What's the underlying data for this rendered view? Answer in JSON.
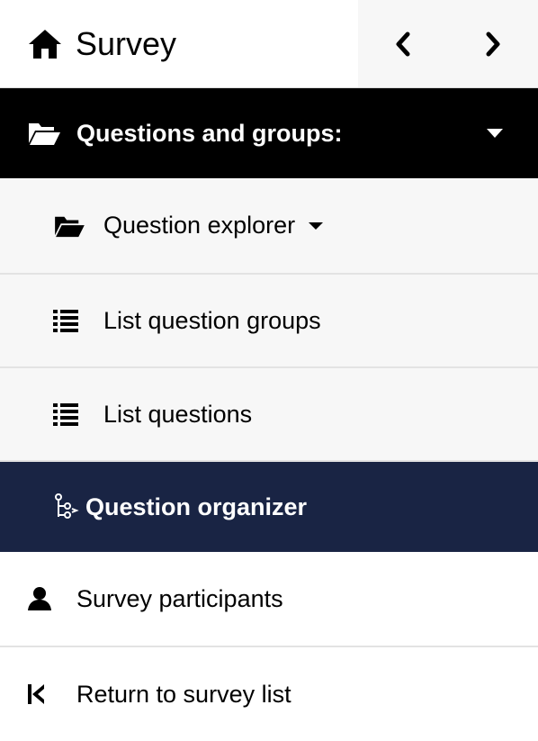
{
  "header": {
    "home_label": "Survey",
    "home_icon": "home-icon",
    "prev_icon": "chevron-left-icon",
    "next_icon": "chevron-right-icon"
  },
  "section": {
    "label": "Questions and groups:",
    "icon": "folder-open-icon",
    "expanded": true
  },
  "sub_items": [
    {
      "label": "Question explorer",
      "icon": "folder-open-icon",
      "has_dropdown": true
    },
    {
      "label": "List question groups",
      "icon": "list-icon"
    },
    {
      "label": "List questions",
      "icon": "list-icon"
    }
  ],
  "active_item": {
    "label": "Question organizer",
    "icon": "organizer-icon"
  },
  "main_items": [
    {
      "label": "Survey participants",
      "icon": "user-icon"
    },
    {
      "label": "Return to survey list",
      "icon": "step-backward-icon"
    }
  ],
  "colors": {
    "section_bg": "#000000",
    "active_bg": "#192444",
    "sub_bg": "#f7f7f7",
    "border": "#e3e3e3"
  }
}
